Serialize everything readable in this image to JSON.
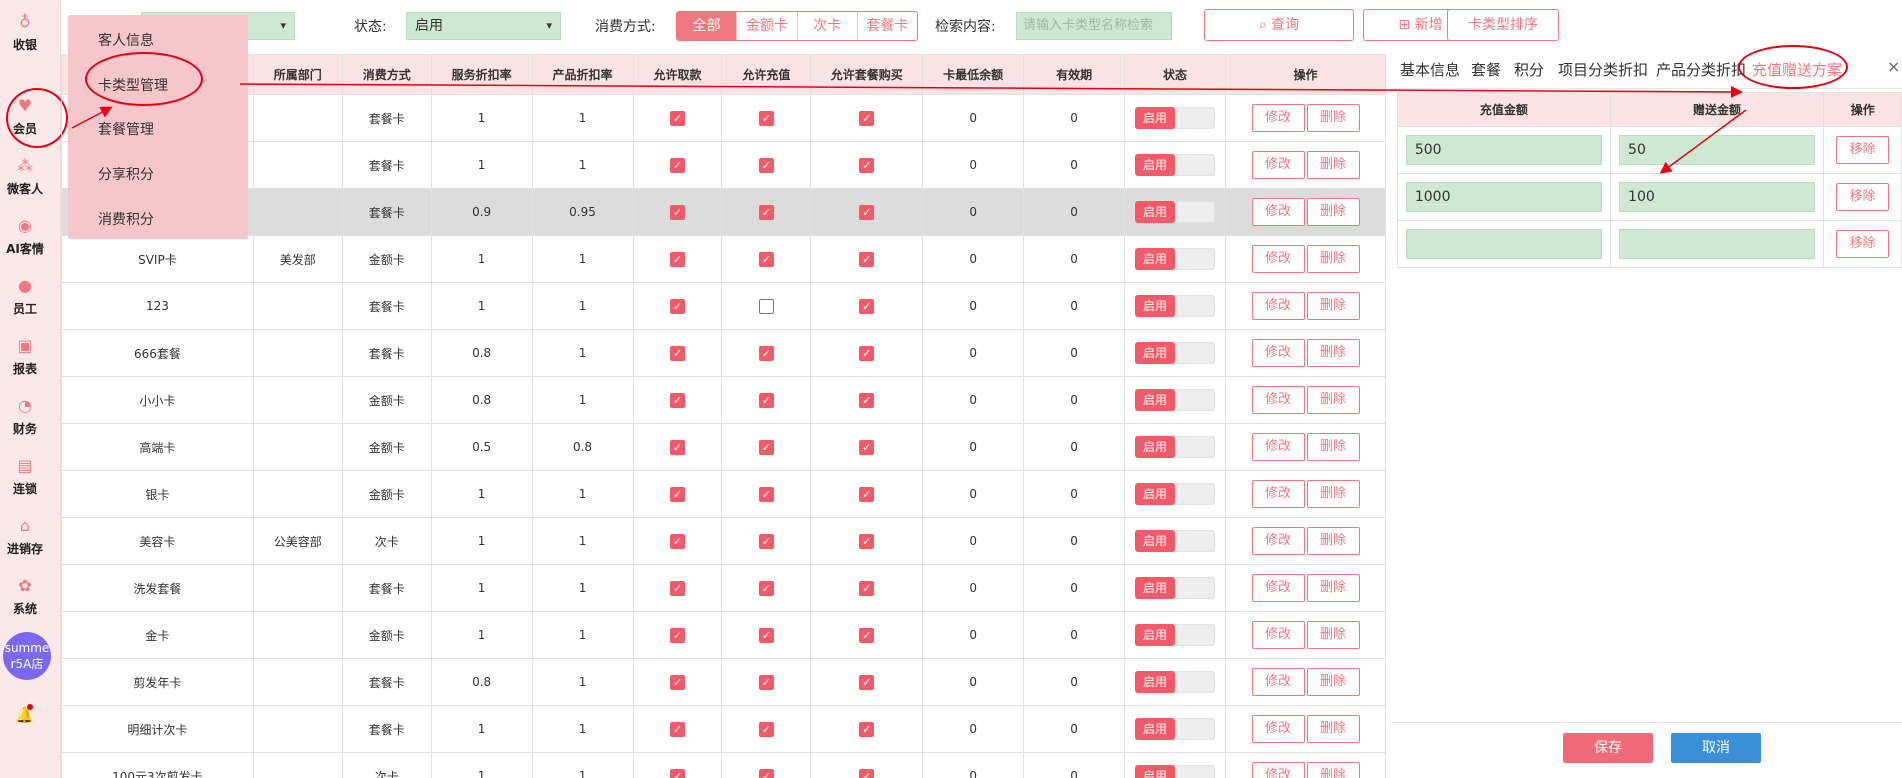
{
  "nav": {
    "items": [
      {
        "label": "收银",
        "icon": "cashier-icon",
        "glyph": "♁"
      },
      {
        "label": "会员",
        "icon": "heart-icon",
        "glyph": "♥"
      },
      {
        "label": "微客人",
        "icon": "customers-icon",
        "glyph": "⁂"
      },
      {
        "label": "AI客情",
        "icon": "ai-icon",
        "glyph": "◉"
      },
      {
        "label": "员工",
        "icon": "staff-icon",
        "glyph": "●"
      },
      {
        "label": "报表",
        "icon": "report-icon",
        "glyph": "▣"
      },
      {
        "label": "财务",
        "icon": "finance-icon",
        "glyph": "◔"
      },
      {
        "label": "连锁",
        "icon": "chain-icon",
        "glyph": "▤"
      },
      {
        "label": "进销存",
        "icon": "inventory-icon",
        "glyph": "⌂"
      },
      {
        "label": "系统",
        "icon": "gear-icon",
        "glyph": "✿"
      }
    ],
    "store": "summer5A店",
    "bell_glyph": "🔔"
  },
  "flyout": {
    "items": [
      "客人信息",
      "卡类型管理",
      "套餐管理",
      "分享积分",
      "消费积分"
    ]
  },
  "filter": {
    "status_label": "状态:",
    "status_value": "启用",
    "pay_label": "消费方式:",
    "pay_options": [
      "全部",
      "金额卡",
      "次卡",
      "套餐卡"
    ],
    "search_label": "检索内容:",
    "search_placeholder": "请输入卡类型名称检索",
    "query_button": "查询",
    "add_button": "新增",
    "sort_button": "卡类型排序",
    "dropdown_arrow": "▾",
    "search_glyph": "⌕",
    "add_glyph": "⊞"
  },
  "table": {
    "headers": [
      "",
      "所属部门",
      "消费方式",
      "服务折扣率",
      "产品折扣率",
      "允许取款",
      "允许充值",
      "允许套餐购买",
      "卡最低余额",
      "有效期",
      "状态",
      "操作"
    ],
    "rows": [
      {
        "name": "",
        "dept": "",
        "method": "套餐卡",
        "svc": "1",
        "prod": "1",
        "withdraw": true,
        "recharge": true,
        "pkg": true,
        "min": "0",
        "valid": "0",
        "status": "启用"
      },
      {
        "name": "",
        "dept": "",
        "method": "套餐卡",
        "svc": "1",
        "prod": "1",
        "withdraw": true,
        "recharge": true,
        "pkg": true,
        "min": "0",
        "valid": "0",
        "status": "启用"
      },
      {
        "name": "",
        "dept": "",
        "method": "套餐卡",
        "svc": "0.9",
        "prod": "0.95",
        "withdraw": true,
        "recharge": true,
        "pkg": true,
        "min": "0",
        "valid": "0",
        "status": "启用",
        "selected": true
      },
      {
        "name": "SVIP卡",
        "dept": "美发部",
        "method": "金额卡",
        "svc": "1",
        "prod": "1",
        "withdraw": true,
        "recharge": true,
        "pkg": true,
        "min": "0",
        "valid": "0",
        "status": "启用"
      },
      {
        "name": "123",
        "dept": "",
        "method": "套餐卡",
        "svc": "1",
        "prod": "1",
        "withdraw": true,
        "recharge": false,
        "pkg": true,
        "min": "0",
        "valid": "0",
        "status": "启用"
      },
      {
        "name": "666套餐",
        "dept": "",
        "method": "套餐卡",
        "svc": "0.8",
        "prod": "1",
        "withdraw": true,
        "recharge": true,
        "pkg": true,
        "min": "0",
        "valid": "0",
        "status": "启用"
      },
      {
        "name": "小小卡",
        "dept": "",
        "method": "金额卡",
        "svc": "0.8",
        "prod": "1",
        "withdraw": true,
        "recharge": true,
        "pkg": true,
        "min": "0",
        "valid": "0",
        "status": "启用"
      },
      {
        "name": "高端卡",
        "dept": "",
        "method": "金额卡",
        "svc": "0.5",
        "prod": "0.8",
        "withdraw": true,
        "recharge": true,
        "pkg": true,
        "min": "0",
        "valid": "0",
        "status": "启用"
      },
      {
        "name": "银卡",
        "dept": "",
        "method": "金额卡",
        "svc": "1",
        "prod": "1",
        "withdraw": true,
        "recharge": true,
        "pkg": true,
        "min": "0",
        "valid": "0",
        "status": "启用"
      },
      {
        "name": "美容卡",
        "dept": "公美容部",
        "method": "次卡",
        "svc": "1",
        "prod": "1",
        "withdraw": true,
        "recharge": true,
        "pkg": true,
        "min": "0",
        "valid": "0",
        "status": "启用"
      },
      {
        "name": "洗发套餐",
        "dept": "",
        "method": "套餐卡",
        "svc": "1",
        "prod": "1",
        "withdraw": true,
        "recharge": true,
        "pkg": true,
        "min": "0",
        "valid": "0",
        "status": "启用"
      },
      {
        "name": "金卡",
        "dept": "",
        "method": "金额卡",
        "svc": "1",
        "prod": "1",
        "withdraw": true,
        "recharge": true,
        "pkg": true,
        "min": "0",
        "valid": "0",
        "status": "启用"
      },
      {
        "name": "剪发年卡",
        "dept": "",
        "method": "套餐卡",
        "svc": "0.8",
        "prod": "1",
        "withdraw": true,
        "recharge": true,
        "pkg": true,
        "min": "0",
        "valid": "0",
        "status": "启用"
      },
      {
        "name": "明细计次卡",
        "dept": "",
        "method": "套餐卡",
        "svc": "1",
        "prod": "1",
        "withdraw": true,
        "recharge": true,
        "pkg": true,
        "min": "0",
        "valid": "0",
        "status": "启用"
      },
      {
        "name": "100元3次剪发卡",
        "dept": "",
        "method": "次卡",
        "svc": "1",
        "prod": "1",
        "withdraw": true,
        "recharge": true,
        "pkg": true,
        "min": "0",
        "valid": "0",
        "status": "启用"
      }
    ],
    "edit_label": "修改",
    "delete_label": "删除",
    "check_glyph": "✓"
  },
  "panel": {
    "tabs": [
      "基本信息",
      "套餐",
      "积分",
      "项目分类折扣",
      "产品分类折扣",
      "充值赠送方案"
    ],
    "active_tab": 5,
    "close_glyph": "×",
    "headers": [
      "充值金额",
      "赠送金额",
      "操作"
    ],
    "rows": [
      {
        "amount": "500",
        "bonus": "50"
      },
      {
        "amount": "1000",
        "bonus": "100"
      },
      {
        "amount": "",
        "bonus": ""
      }
    ],
    "remove_label": "移除",
    "save_button": "保存",
    "cancel_button": "取消"
  },
  "colors": {
    "accent": "#f07781",
    "nav_bg": "#fbe9ea",
    "input_green": "#cfe8d4",
    "save": "#f06b79",
    "cancel": "#3b8fd8",
    "annotation": "#e60012"
  }
}
